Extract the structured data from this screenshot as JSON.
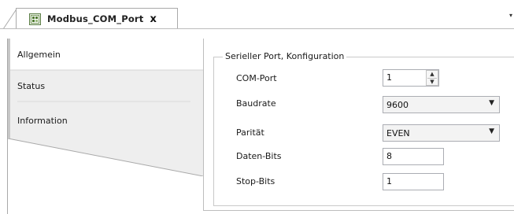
{
  "document_tab": {
    "title": "Modbus_COM_Port",
    "close_label": "x",
    "dropdown_glyph": "▾"
  },
  "nav": {
    "items": [
      {
        "label": "Allgemein",
        "active": true
      },
      {
        "label": "Status",
        "active": false
      },
      {
        "label": "Information",
        "active": false
      }
    ]
  },
  "serial_config": {
    "group_title": "Serieller Port, Konfiguration",
    "com_port": {
      "label": "COM-Port",
      "value": "1"
    },
    "baudrate": {
      "label": "Baudrate",
      "value": "9600"
    },
    "parity": {
      "label": "Parität",
      "value": "EVEN"
    },
    "data_bits": {
      "label": "Daten-Bits",
      "value": "8"
    },
    "stop_bits": {
      "label": "Stop-Bits",
      "value": "1"
    }
  },
  "colors": {
    "border": "#a9a9a9",
    "select_bg": "#f3f3f3",
    "nav_bg": "#eeeeee"
  }
}
